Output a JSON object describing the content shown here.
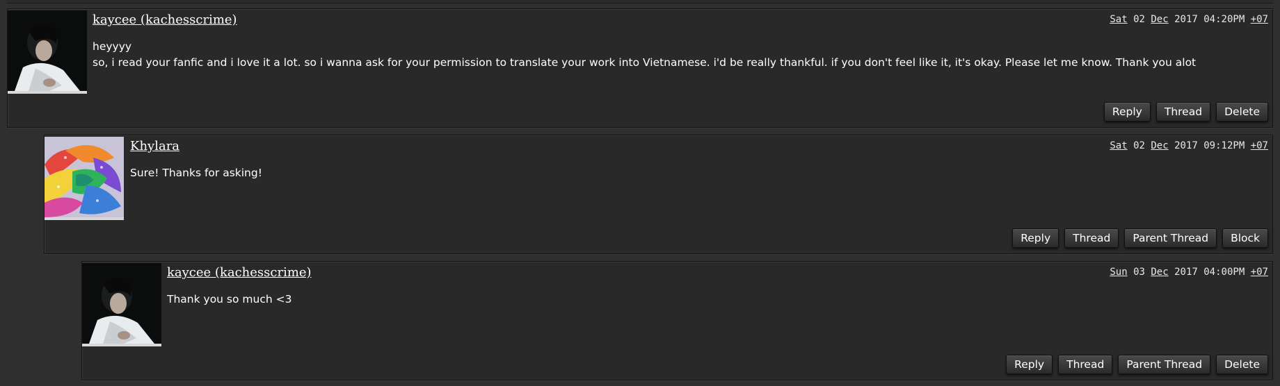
{
  "comments": [
    {
      "username": "kaycee (kachesscrime)",
      "date": {
        "day": "Sat",
        "num": "02",
        "month": "Dec",
        "year_time": "2017 04:20PM",
        "tz": "+07"
      },
      "body": "heyyyy\nso, i read your fanfic and i love it a lot. so i wanna ask for your permission to translate your work into Vietnamese. i'd be really thankful. if you don't feel like it, it's okay. Please let me know. Thank you alot",
      "avatar_icon": "portrait-avatar",
      "actions": [
        "Reply",
        "Thread",
        "Delete"
      ]
    },
    {
      "username": "Khylara",
      "date": {
        "day": "Sat",
        "num": "02",
        "month": "Dec",
        "year_time": "2017 09:12PM",
        "tz": "+07"
      },
      "body": "Sure! Thanks for asking!",
      "avatar_icon": "rainbow-rose-avatar",
      "actions": [
        "Reply",
        "Thread",
        "Parent Thread",
        "Block"
      ]
    },
    {
      "username": "kaycee (kachesscrime)",
      "date": {
        "day": "Sun",
        "num": "03",
        "month": "Dec",
        "year_time": "2017 04:00PM",
        "tz": "+07"
      },
      "body": "Thank you so much <3",
      "avatar_icon": "portrait-avatar",
      "actions": [
        "Reply",
        "Thread",
        "Parent Thread",
        "Delete"
      ]
    }
  ]
}
